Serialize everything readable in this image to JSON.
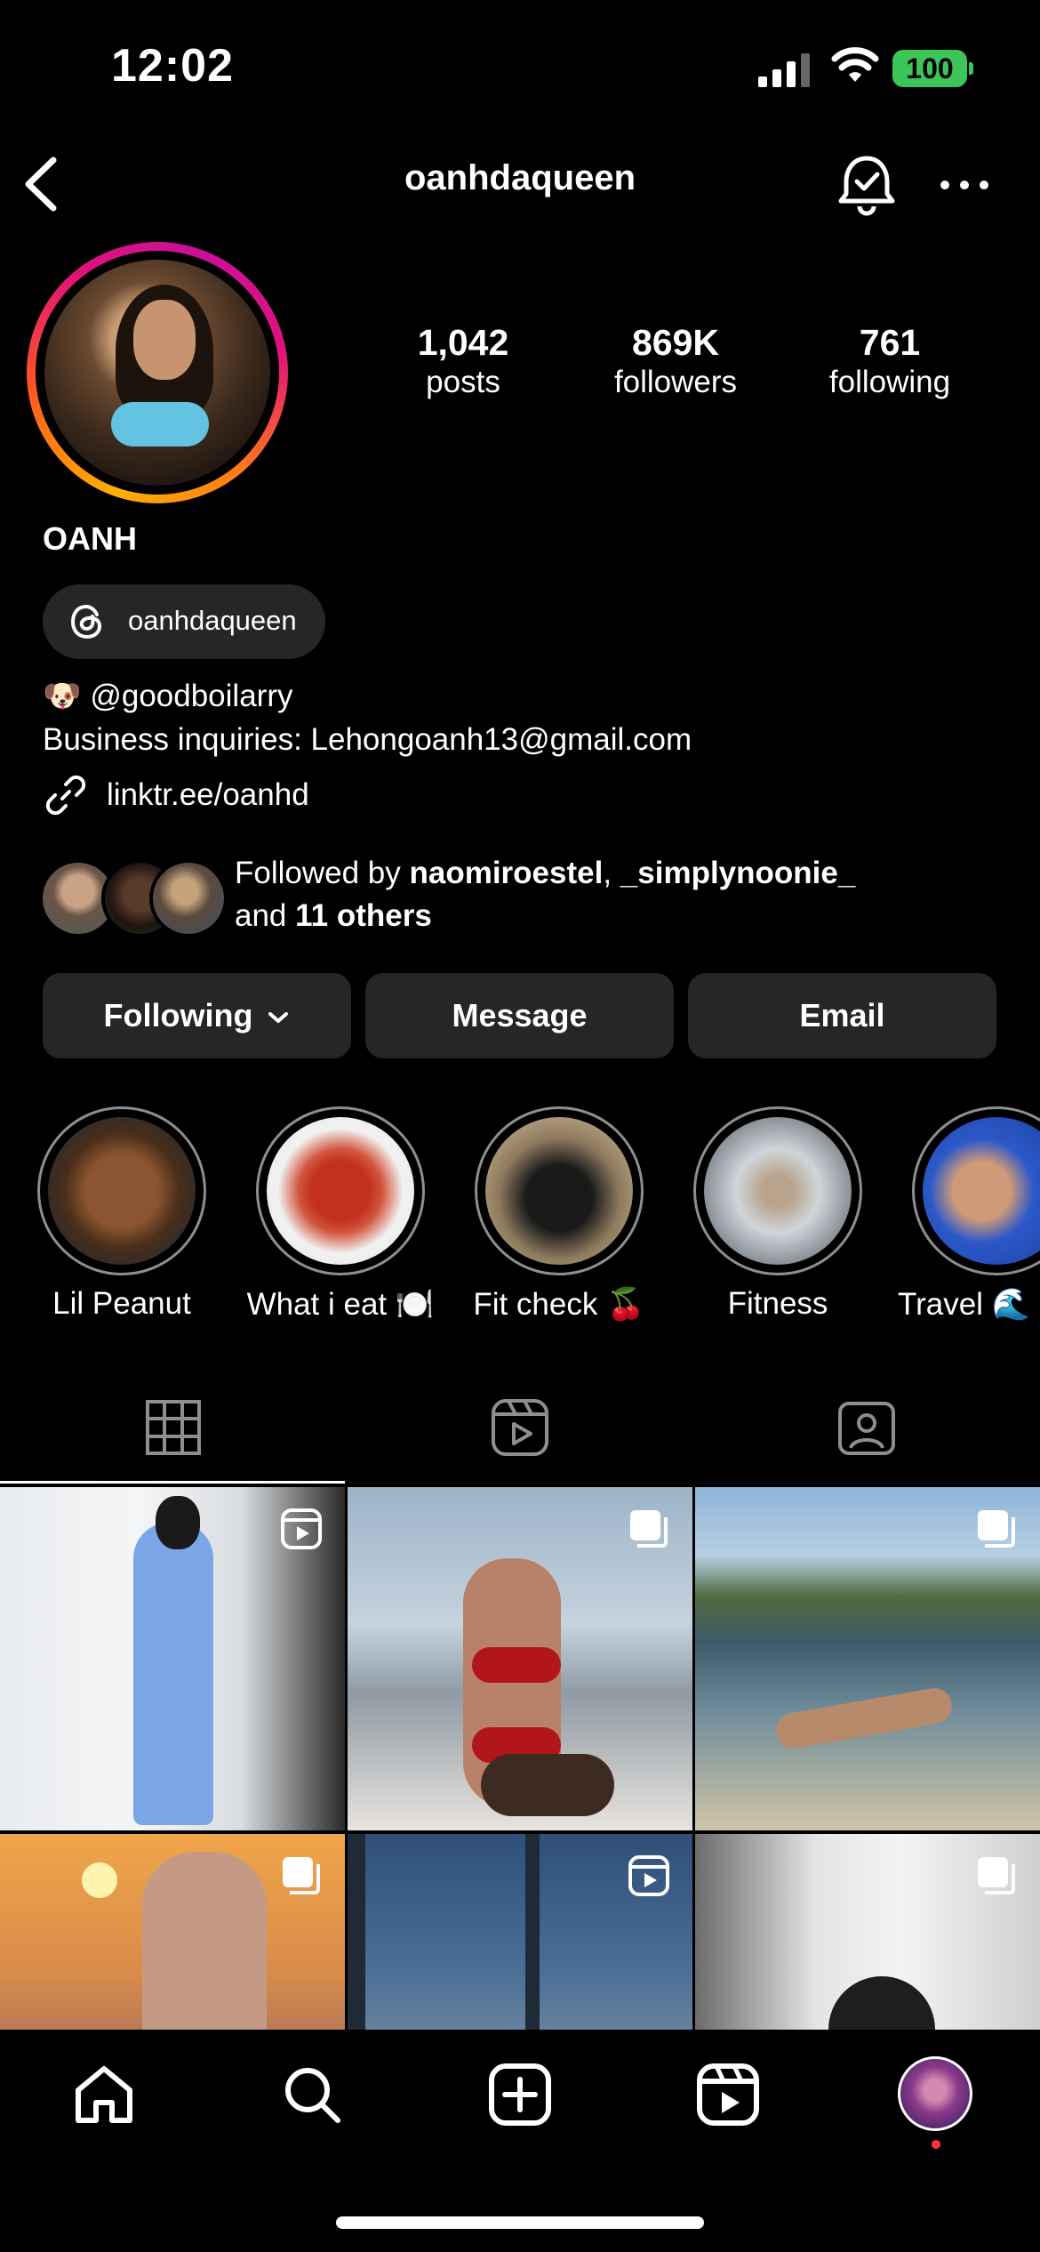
{
  "status_bar": {
    "time": "12:02",
    "battery": "100"
  },
  "header": {
    "username": "oanhdaqueen"
  },
  "profile": {
    "full_name": "OANH",
    "threads_handle": "oanhdaqueen",
    "bio_emoji": "🐶",
    "bio_mention": "@goodboilarry",
    "bio_line2": "Business inquiries: Lehongoanh13@gmail.com",
    "link": "linktr.ee/oanhd"
  },
  "stats": [
    {
      "value": "1,042",
      "label": "posts"
    },
    {
      "value": "869K",
      "label": "followers"
    },
    {
      "value": "761",
      "label": "following"
    }
  ],
  "followed_by": {
    "prefix": "Followed by ",
    "user1": "naomiroestel",
    "sep": ", ",
    "user2": "_simplynoonie_",
    "and": "and ",
    "others": "11 others"
  },
  "actions": {
    "following": "Following",
    "message": "Message",
    "email": "Email"
  },
  "highlights": [
    {
      "label": "Lil Peanut"
    },
    {
      "label": "What i eat 🍽️"
    },
    {
      "label": "Fit check 🍒"
    },
    {
      "label": "Fitness"
    },
    {
      "label": "Travel 🌊"
    }
  ],
  "tabs": [
    "grid-icon",
    "reels-icon",
    "tagged-icon"
  ],
  "grid": [
    {
      "badge": "reel"
    },
    {
      "badge": "carousel"
    },
    {
      "badge": "carousel"
    },
    {
      "badge": "carousel"
    },
    {
      "badge": "reel"
    },
    {
      "badge": "carousel"
    }
  ],
  "colors": {
    "background": "#000000",
    "button": "#262626",
    "battery": "#3cc65a"
  }
}
